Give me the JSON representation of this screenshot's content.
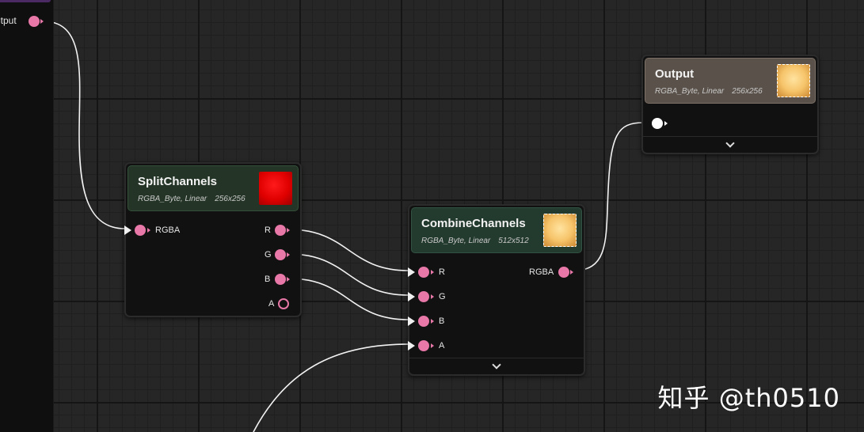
{
  "left_panel": {
    "output_label": "utput"
  },
  "split_node": {
    "title": "SplitChannels",
    "format": "RGBA_Byte, Linear",
    "size": "256x256",
    "input_label": "RGBA",
    "outputs": [
      "R",
      "G",
      "B",
      "A"
    ],
    "thumb_color": "#ff0000"
  },
  "combine_node": {
    "title": "CombineChannels",
    "format": "RGBA_Byte, Linear",
    "size": "512x512",
    "inputs": [
      "R",
      "G",
      "B",
      "A"
    ],
    "output_label": "RGBA"
  },
  "output_node": {
    "title": "Output",
    "format": "RGBA_Byte, Linear",
    "size": "256x256"
  },
  "watermark": "知乎 @th0510",
  "colors": {
    "pin": "#e878a8",
    "split_header": "#243527",
    "combine_header": "#233a2e",
    "output_header": "#5a524a"
  }
}
